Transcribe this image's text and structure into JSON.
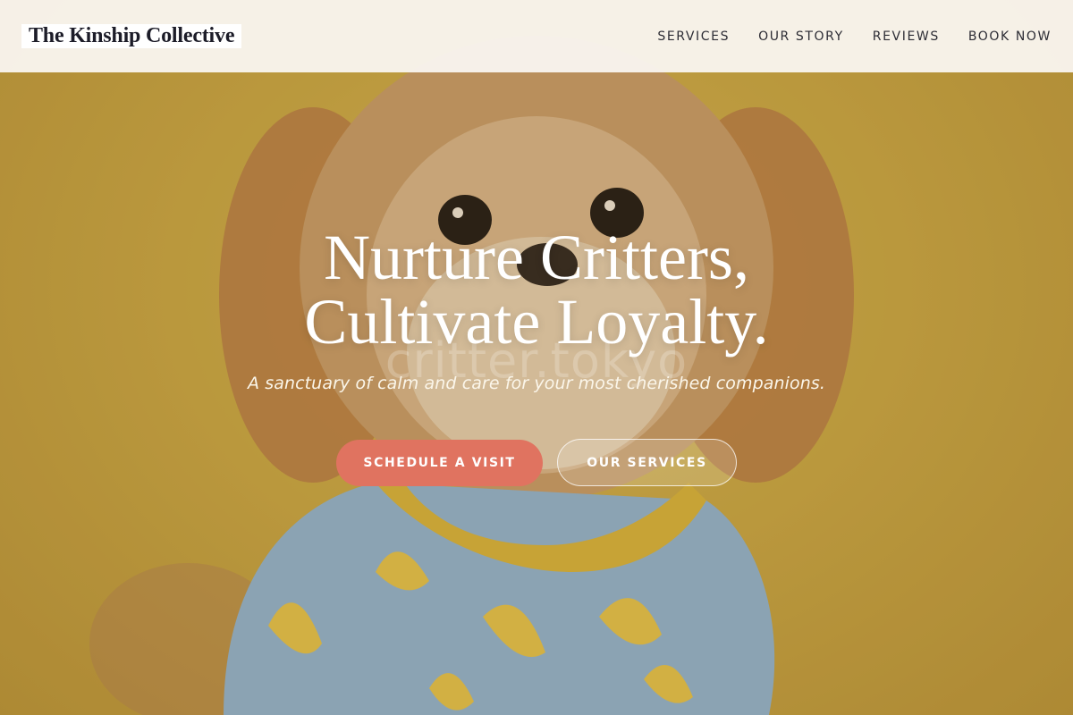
{
  "header": {
    "logo": "The Kinship Collective",
    "nav": [
      "SERVICES",
      "OUR STORY",
      "REVIEWS",
      "BOOK NOW"
    ]
  },
  "hero": {
    "headline_line1": "Nurture Critters,",
    "headline_line2": "Cultivate Loyalty.",
    "tagline": "A sanctuary of calm and care for your most cherished companions.",
    "watermark": "critter.tokyo",
    "primary_cta": "SCHEDULE A VISIT",
    "secondary_cta": "OUR SERVICES",
    "background_image": "fluffy-dog-in-banana-shirt"
  },
  "colors": {
    "accent": "#e07360",
    "background": "#c9a643",
    "header_bg": "#faf7f2",
    "text_dark": "#1c1c28"
  }
}
